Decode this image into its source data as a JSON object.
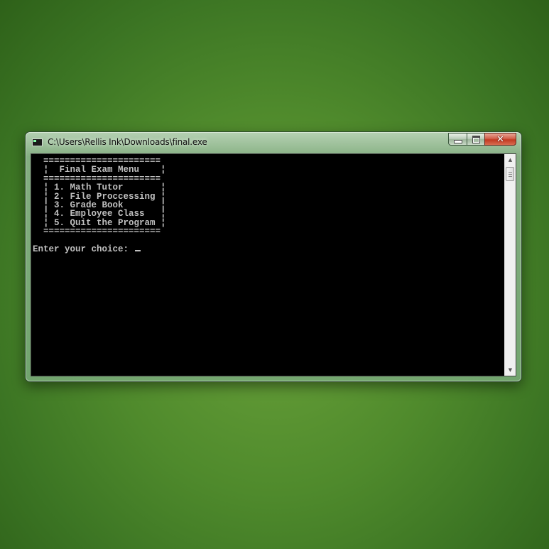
{
  "window": {
    "title": "C:\\Users\\Rellis Ink\\Downloads\\final.exe",
    "controls": {
      "minimize": "minimize",
      "maximize": "maximize",
      "close": "close"
    }
  },
  "console": {
    "lines": [
      "  ======================",
      "  ¦  Final Exam Menu    ¦",
      "  ======================",
      "  ¦ 1. Math Tutor       ¦",
      "  ¦ 2. File Proccessing ¦",
      "  ¦ 3. Grade Book       ¦",
      "  ¦ 4. Employee Class   ¦",
      "  ¦ 5. Quit the Program ¦",
      "  ======================",
      ""
    ],
    "prompt": "Enter your choice: "
  },
  "scrollbar": {
    "up_arrow": "▲",
    "down_arrow": "▼"
  },
  "icons": [
    "console-app-icon",
    "minimize-icon",
    "maximize-icon",
    "close-icon",
    "scroll-up-icon",
    "scroll-down-icon"
  ],
  "colors": {
    "console_bg": "#000000",
    "console_text": "#c0c0c0",
    "close_button": "#c23a22"
  }
}
